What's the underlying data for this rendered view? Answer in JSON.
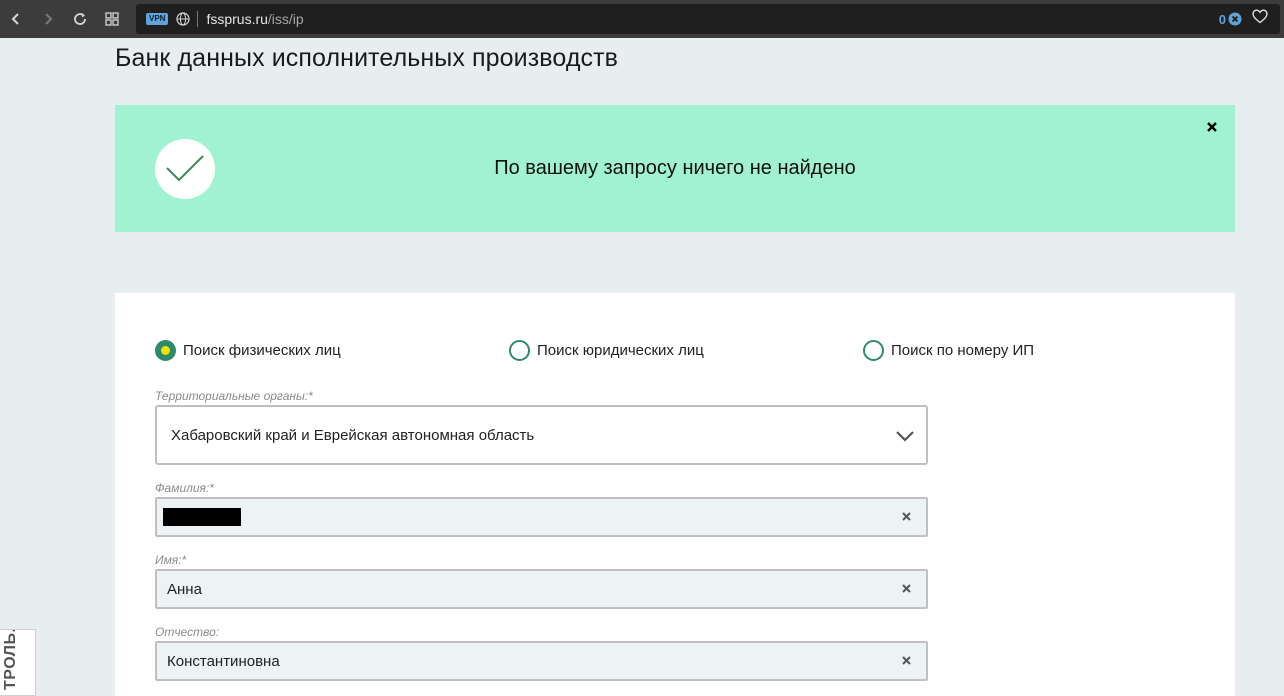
{
  "browser": {
    "vpn_label": "VPN",
    "url_host": "fssprus.ru",
    "url_path": "/iss/ip",
    "blocked_count": "0"
  },
  "page": {
    "title": "Банк данных исполнительных производств"
  },
  "alert": {
    "message": "По вашему запросу ничего не найдено",
    "background": "#a1f2d2"
  },
  "search": {
    "tabs": [
      {
        "label": "Поиск физических лиц",
        "selected": true
      },
      {
        "label": "Поиск юридических лиц",
        "selected": false
      },
      {
        "label": "Поиск по номеру ИП",
        "selected": false
      }
    ],
    "region": {
      "label": "Территориальные органы:*",
      "value": "Хабаровский край и Еврейская автономная область"
    },
    "last_name": {
      "label": "Фамилия:*",
      "value": ""
    },
    "first_name": {
      "label": "Имя:*",
      "value": "Анна"
    },
    "patronymic": {
      "label": "Отчество:",
      "value": "Константиновна"
    }
  },
  "side_tab": {
    "label": "ТРОЛЬ."
  },
  "colors": {
    "accent": "#2e8b6a",
    "radio_dot": "#f5e100"
  }
}
